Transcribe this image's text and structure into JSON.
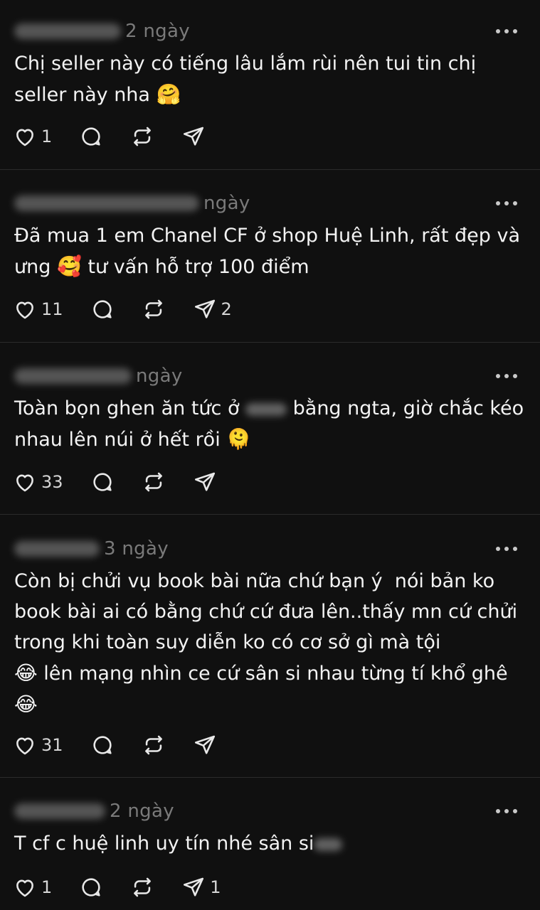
{
  "posts": [
    {
      "time": "2 ngày",
      "text_before": "Chị seller này có tiếng lâu lắm rùi nên tui tin chị seller này nha ",
      "censored": "",
      "text_after": "",
      "emoji": "🤗",
      "likes": "1",
      "reposts": "",
      "shares": ""
    },
    {
      "time": "ngày",
      "text_before": "Đã mua 1 em Chanel CF ở shop Huệ Linh, rất đẹp và ưng ",
      "censored": "",
      "text_after": "",
      "emoji": "🥰",
      "emoji_tail": " tư vấn hỗ trợ 100 điểm",
      "likes": "11",
      "shares": "2"
    },
    {
      "time": "ngày",
      "text_before": "Toàn bọn ghen ăn tức ở ",
      "censored": "",
      "text_after": " bằng ngta, giờ chắc kéo nhau lên núi ở hết rồi ",
      "emoji": "🫠",
      "likes": "33",
      "shares": ""
    },
    {
      "time": "3 ngày",
      "text_before": "Còn bị chửi vụ book bài nữa chứ bạn ý  nói bản ko book bài ai có bằng chứ cứ đưa lên..thấy mn cứ chửi trong khi toàn suy diễn ko có cơ sở gì mà tội\n",
      "censored": "",
      "text_after": "",
      "emoji": "😂",
      "emoji_tail": " lên mạng nhìn ce cứ sân si nhau từng tí khổ ghê\n",
      "emoji2": "😂",
      "likes": "31",
      "shares": ""
    },
    {
      "time": "2 ngày",
      "text_before": "T cf c huệ linh uy tín nhé sân si",
      "censored": "",
      "text_after": "",
      "emoji": "",
      "likes": "1",
      "shares": "1"
    }
  ],
  "icons": {
    "like": "heart-icon",
    "reply": "comment-icon",
    "repost": "repost-icon",
    "share": "send-icon",
    "more": "more-dots-icon"
  }
}
